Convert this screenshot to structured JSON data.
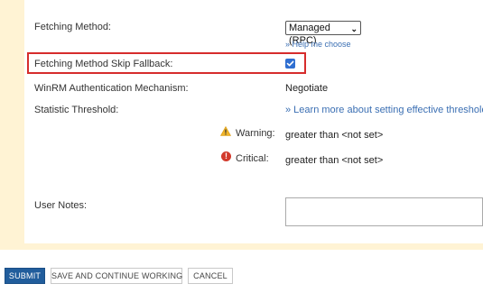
{
  "form": {
    "fetching_method": {
      "label": "Fetching Method:",
      "selected": "Managed (RPC)",
      "help_link": "» Help me choose"
    },
    "skip_fallback": {
      "label": "Fetching Method Skip Fallback:",
      "checked": true
    },
    "winrm": {
      "label": "WinRM Authentication Mechanism:",
      "value": "Negotiate"
    },
    "statistic_threshold": {
      "label": "Statistic Threshold:",
      "link": "» Learn more about setting effective thresholds",
      "warning_label": "Warning:",
      "warning_value": "greater than <not set>",
      "critical_label": "Critical:",
      "critical_value": "greater than <not set>"
    },
    "user_notes": {
      "label": "User Notes:",
      "value": ""
    }
  },
  "buttons": {
    "submit": "SUBMIT",
    "save_continue": "SAVE AND CONTINUE WORKING",
    "cancel": "CANCEL"
  },
  "colors": {
    "highlight_border": "#d62c2c",
    "primary_button": "#215d9c",
    "link": "#3b6fb3",
    "panel_frame": "#fff3d4",
    "checkbox": "#2f6fd1"
  }
}
